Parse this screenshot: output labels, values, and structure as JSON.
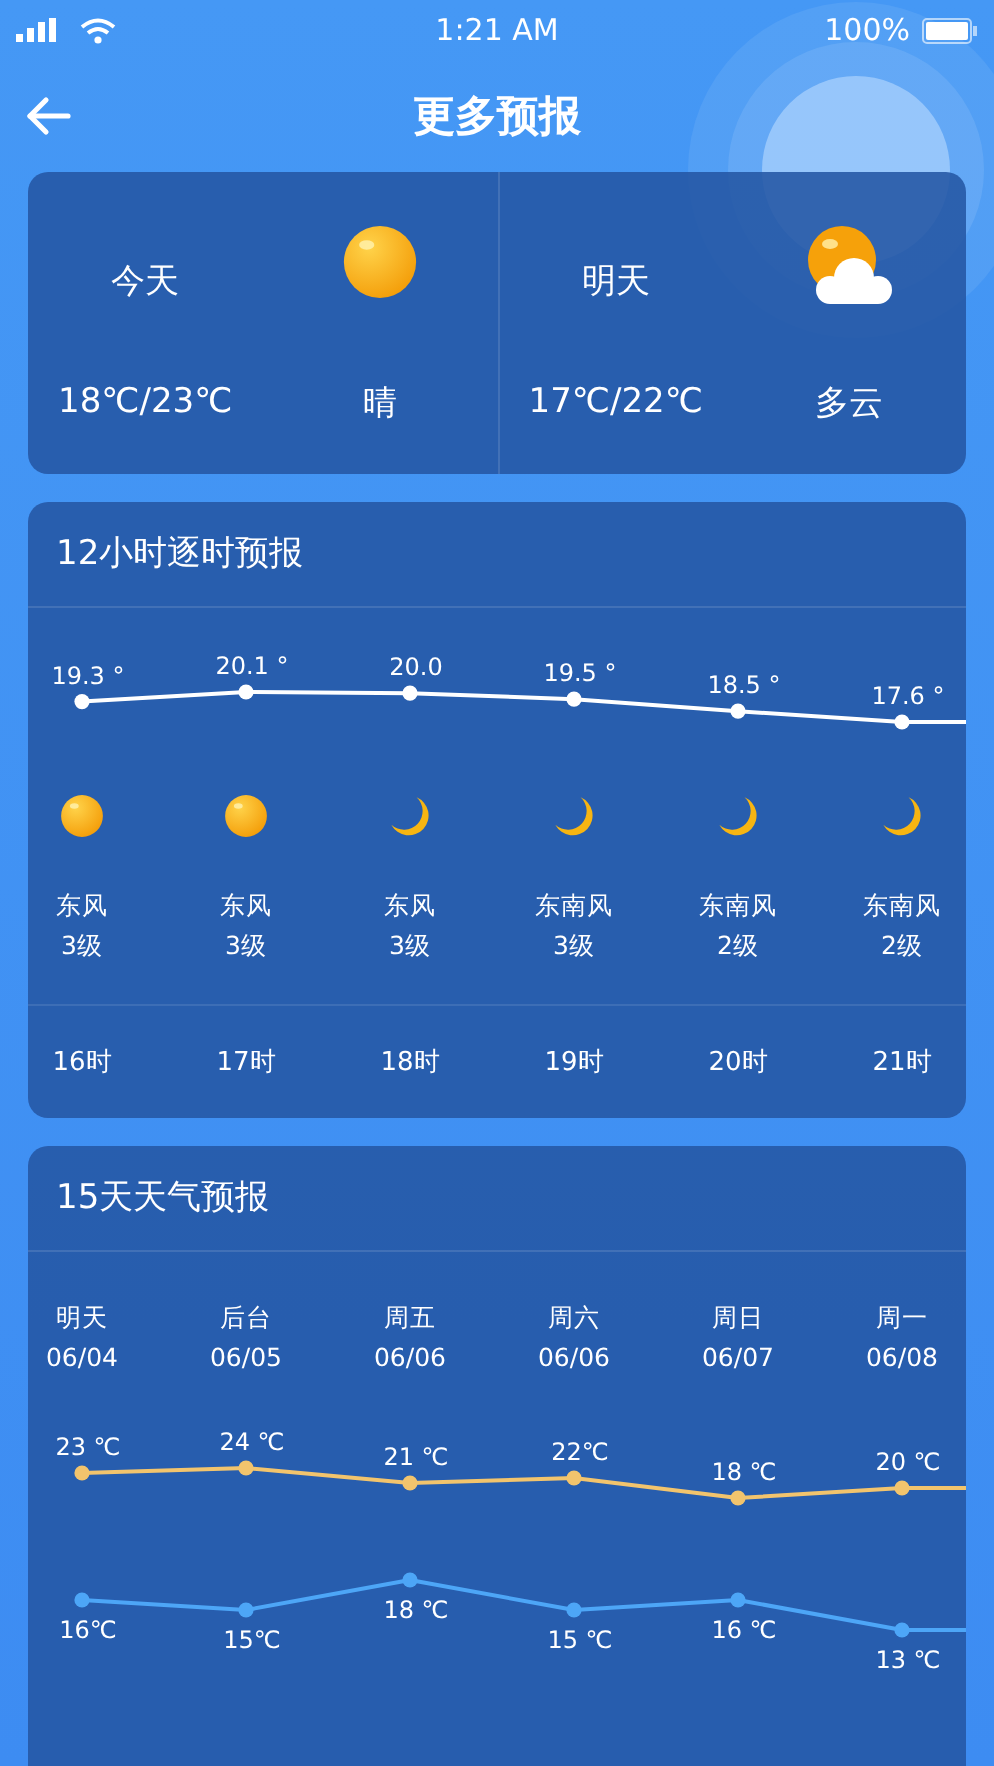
{
  "status_bar": {
    "time": "1:21 AM",
    "battery": "100%"
  },
  "header": {
    "title": "更多预报"
  },
  "summary": [
    {
      "label": "今天",
      "temps": "18℃/23℃",
      "condition": "晴",
      "kind": "sunny"
    },
    {
      "label": "明天",
      "temps": "17℃/22℃",
      "condition": "多云",
      "kind": "cloudy"
    }
  ],
  "hourly": {
    "title": "12小时逐时预报",
    "chart_data": {
      "type": "line",
      "categories": [
        null,
        null,
        null,
        null,
        null,
        null
      ],
      "series": [
        {
          "color": "#ffffff",
          "marker": "circle",
          "values": [
            19.3,
            20.1,
            20.0,
            19.5,
            18.5,
            17.6
          ],
          "value_labels": [
            "19.3 °",
            "20.1 °",
            "20.0",
            "19.5 °",
            "18.5 °",
            "17.6 °"
          ]
        }
      ]
    },
    "hours": [
      {
        "kind": "sun",
        "wind": "东风",
        "level": "3级",
        "time": "16时"
      },
      {
        "kind": "sun",
        "wind": "东风",
        "level": "3级",
        "time": "17时"
      },
      {
        "kind": "moon",
        "wind": "东风",
        "level": "3级",
        "time": "18时"
      },
      {
        "kind": "moon",
        "wind": "东南风",
        "level": "3级",
        "time": "19时"
      },
      {
        "kind": "moon",
        "wind": "东南风",
        "level": "2级",
        "time": "20时"
      },
      {
        "kind": "moon",
        "wind": "东南风",
        "level": "2级",
        "time": "21时"
      }
    ]
  },
  "daily": {
    "title": "15天天气预报",
    "days": [
      {
        "name": "明天",
        "date": "06/04"
      },
      {
        "name": "后台",
        "date": "06/05"
      },
      {
        "name": "周五",
        "date": "06/06"
      },
      {
        "name": "周六",
        "date": "06/06"
      },
      {
        "name": "周日",
        "date": "06/07"
      },
      {
        "name": "周一",
        "date": "06/08"
      }
    ],
    "high": {
      "chart_data": {
        "type": "line",
        "categories": [
          null,
          null,
          null,
          null,
          null,
          null
        ],
        "series": [
          {
            "color": "#f2c46d",
            "marker": "circle",
            "values": [
              23,
              24,
              21,
              22,
              18,
              20
            ],
            "value_labels": [
              "23 ℃",
              "24 ℃",
              "21 ℃",
              "22℃",
              "18 ℃",
              "20 ℃"
            ]
          }
        ]
      }
    },
    "low": {
      "chart_data": {
        "type": "line",
        "categories": [
          null,
          null,
          null,
          null,
          null,
          null
        ],
        "series": [
          {
            "color": "#4da6f7",
            "marker": "circle",
            "values": [
              16,
              15,
              18,
              15,
              16,
              13
            ],
            "value_labels": [
              "16℃",
              "15℃",
              "18 ℃",
              "15 ℃",
              "16 ℃",
              "13 ℃"
            ]
          }
        ]
      }
    }
  }
}
